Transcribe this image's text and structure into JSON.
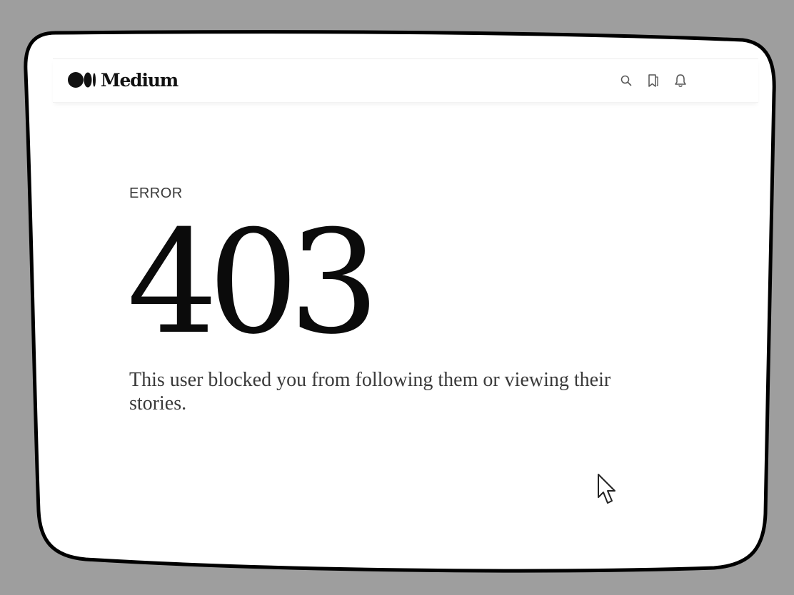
{
  "header": {
    "brand": "Medium",
    "icons": [
      "search-icon",
      "bookmark-icon",
      "notification-bell-icon"
    ]
  },
  "error": {
    "label": "ERROR",
    "code": "403",
    "message": "This user blocked you from following them or viewing their stories."
  },
  "colors": {
    "backdrop": "#9e9e9e",
    "page": "#ffffff",
    "text_primary": "#0b0b0b",
    "text_secondary": "#3a3a3a"
  }
}
